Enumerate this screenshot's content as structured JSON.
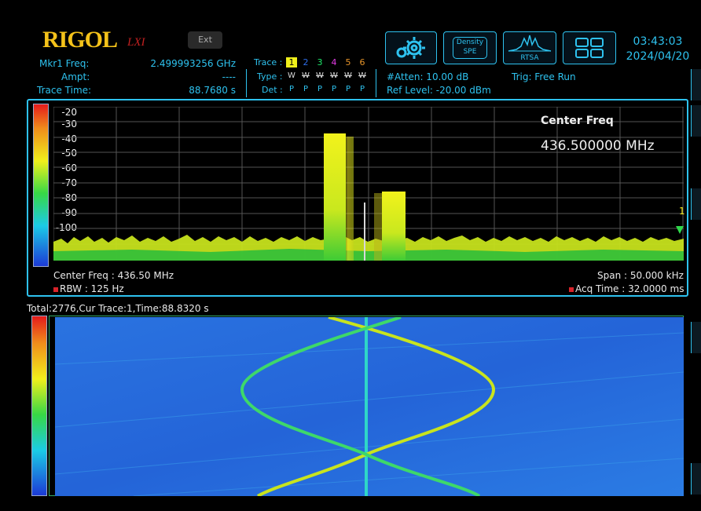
{
  "brand": {
    "logo": "RIGOL",
    "lxi": "LXI",
    "ext": "Ext"
  },
  "markers": {
    "mkr_label": "Mkr1 Freq:",
    "mkr_value": "2.499993256 GHz",
    "ampt_label": "Ampt:",
    "ampt_value": "----",
    "trace_time_label": "Trace Time:",
    "trace_time_value": "88.7680 s"
  },
  "trace": {
    "label": "Trace :",
    "type_label": "Type :",
    "det_label": "Det :",
    "numbers": [
      "1",
      "2",
      "3",
      "4",
      "5",
      "6"
    ],
    "number_colors": [
      "#f0f01b",
      "#2e6de8",
      "#1ee86a",
      "#e23be3",
      "#e8952a",
      "#e8952a"
    ],
    "types": [
      "W",
      "W",
      "W",
      "W",
      "W",
      "W"
    ],
    "dets": [
      "P",
      "P",
      "P",
      "P",
      "P",
      "P"
    ]
  },
  "status": {
    "atten": "#Atten: 10.00 dB",
    "ref_level": "Ref Level: -20.00 dBm",
    "trig": "Trig: Free Run"
  },
  "toolbar": {
    "settings_icon": "gear-icon",
    "density": "Density",
    "spe": "SPE",
    "rtsa": "RTSA",
    "layout_icon": "grid-icon"
  },
  "clock": {
    "time": "03:43:03",
    "date": "2024/04/20"
  },
  "spectrum": {
    "y_ticks": [
      "-20",
      "-30",
      "-40",
      "-50",
      "-60",
      "-70",
      "-80",
      "-90",
      "-100"
    ],
    "center_freq_title": "Center Freq",
    "center_freq_value": "436.500000 MHz",
    "center_freq_info": "Center Freq : 436.50 MHz",
    "rbw": "RBW : 125 Hz",
    "span": "Span : 50.000 kHz",
    "acq_time": "Acq Time : 32.0000 ms",
    "marker_label": "1"
  },
  "waterfall": {
    "header": "Total:2776,Cur Trace:1,Time:88.8320 s"
  }
}
